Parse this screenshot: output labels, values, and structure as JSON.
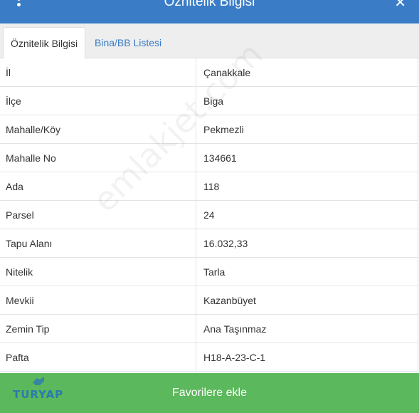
{
  "header": {
    "title": "Öznitelik Bilgisi"
  },
  "tabs": [
    {
      "label": "Öznitelik Bilgisi"
    },
    {
      "label": "Bina/BB Listesi"
    }
  ],
  "rows": [
    {
      "key": "İl",
      "value": "Çanakkale"
    },
    {
      "key": "İlçe",
      "value": "Biga"
    },
    {
      "key": "Mahalle/Köy",
      "value": "Pekmezli"
    },
    {
      "key": "Mahalle No",
      "value": "134661"
    },
    {
      "key": "Ada",
      "value": "118"
    },
    {
      "key": "Parsel",
      "value": "24"
    },
    {
      "key": "Tapu Alanı",
      "value": "16.032,33"
    },
    {
      "key": "Nitelik",
      "value": "Tarla"
    },
    {
      "key": "Mevkii",
      "value": "Kazanbüyet"
    },
    {
      "key": "Zemin Tip",
      "value": "Ana Taşınmaz"
    },
    {
      "key": "Pafta",
      "value": "H18-A-23-C-1"
    }
  ],
  "footer": {
    "button_label": "Favorilere ekle"
  },
  "logo": {
    "text": "TURYAP"
  },
  "watermark": {
    "text": "emlakjet.com"
  },
  "colors": {
    "header": "#3a7cc6",
    "footer": "#5cb85c",
    "tab_link": "#3a7cc6"
  },
  "icons": {
    "menu": "kebab-menu-icon",
    "close": "close-icon"
  }
}
